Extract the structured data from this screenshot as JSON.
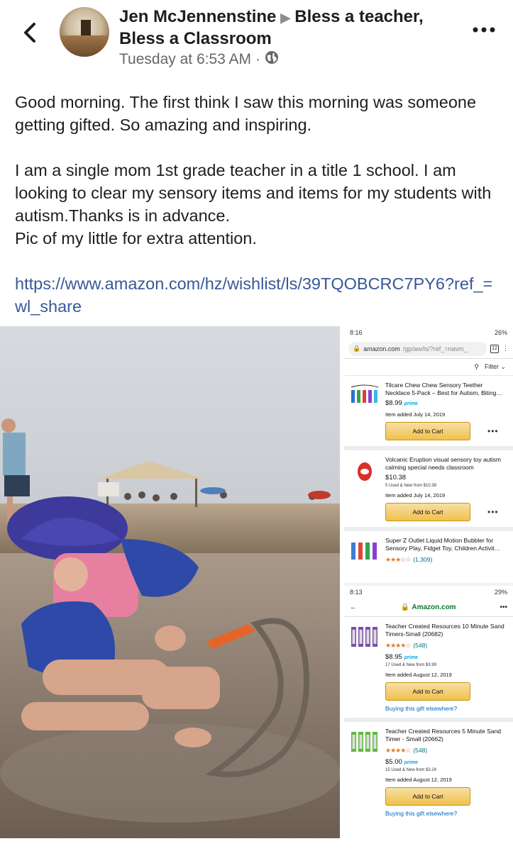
{
  "header": {
    "author": "Jen McJennenstine",
    "group": "Bless a teacher, Bless a Classroom",
    "timestamp": "Tuesday at 6:53 AM",
    "separator": "·"
  },
  "post": {
    "para1": "Good morning. The first think I saw this morning was someone getting gifted. So amazing and inspiring.",
    "para2_line1": "I am a single mom 1st grade teacher in a title 1 school. I am looking to clear my sensory items and items for my students with autism.Thanks is in advance.",
    "para2_line2": "Pic of my little for extra attention.",
    "link": "https://www.amazon.com/hz/wishlist/ls/39TQOBCRC7PY6?ref_=wl_share"
  },
  "shot1": {
    "time": "8:16",
    "battery": "26%",
    "url_host": "amazon.com",
    "url_path": "/gp/aw/ls/?ref_=navm_",
    "tab_count": "12",
    "filter_label": "Filter",
    "items": [
      {
        "name": "Tilcare Chew Chew Sensory Teether Necklace 5-Pack – Best for Autism, Biting…",
        "price": "$8.99",
        "prime": "prime",
        "added": "Item added July 14, 2019",
        "button": "Add to Cart"
      },
      {
        "name": "Volcanic Eruption visual sensory toy autism calming special needs classroom",
        "price": "$10.38",
        "used": "5 Used & New from $10.38",
        "added": "Item added July 14, 2019",
        "button": "Add to Cart"
      },
      {
        "name": "Super Z Outlet Liquid Motion Bubbler for Sensory Play, Fidget Toy, Children Activit…",
        "stars": "★★★☆☆",
        "reviews": "(1,309)"
      }
    ]
  },
  "shot2": {
    "time": "8:13",
    "battery": "29%",
    "site": "Amazon.com",
    "items": [
      {
        "name": "Teacher Created Resources 10 Minute Sand Timers-Small (20682)",
        "stars": "★★★★☆",
        "reviews": "(548)",
        "price": "$8.95",
        "prime": "prime",
        "used": "17 Used & New from $3.99",
        "added": "Item added August 12, 2019",
        "button": "Add to Cart",
        "gift_link": "Buying this gift elsewhere?"
      },
      {
        "name": "Teacher Created Resources 5 Minute Sand Timer - Small (20662)",
        "stars": "★★★★☆",
        "reviews": "(548)",
        "price": "$5.00",
        "prime": "prime",
        "used": "15 Used & New from $3.24",
        "added": "Item added August 12, 2019",
        "button": "Add to Cart",
        "gift_link": "Buying this gift elsewhere?"
      }
    ]
  }
}
